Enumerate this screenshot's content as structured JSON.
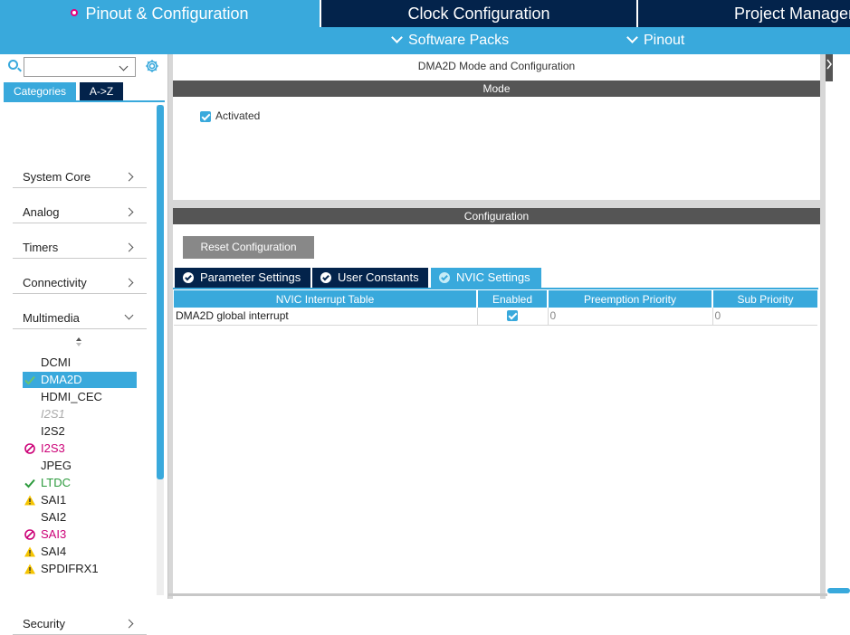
{
  "top_tabs": {
    "pinout": "Pinout & Configuration",
    "clock": "Clock Configuration",
    "project": "Project Manager"
  },
  "sub_menu": {
    "software_packs": "Software Packs",
    "pinout": "Pinout"
  },
  "left": {
    "search": {
      "value": "",
      "placeholder": ""
    },
    "view_tabs": {
      "categories": "Categories",
      "az": "A->Z"
    },
    "categories": [
      {
        "label": "System Core"
      },
      {
        "label": "Analog"
      },
      {
        "label": "Timers"
      },
      {
        "label": "Connectivity"
      },
      {
        "label": "Multimedia"
      },
      {
        "label": "Security"
      }
    ],
    "multimedia_items": [
      {
        "label": "DCMI",
        "status": "none"
      },
      {
        "label": "DMA2D",
        "status": "ok-selected"
      },
      {
        "label": "HDMI_CEC",
        "status": "none"
      },
      {
        "label": "I2S1",
        "status": "disabled"
      },
      {
        "label": "I2S2",
        "status": "none"
      },
      {
        "label": "I2S3",
        "status": "error"
      },
      {
        "label": "JPEG",
        "status": "none"
      },
      {
        "label": "LTDC",
        "status": "ok"
      },
      {
        "label": "SAI1",
        "status": "warning"
      },
      {
        "label": "SAI2",
        "status": "none"
      },
      {
        "label": "SAI3",
        "status": "error"
      },
      {
        "label": "SAI4",
        "status": "warning"
      },
      {
        "label": "SPDIFRX1",
        "status": "warning"
      }
    ]
  },
  "main": {
    "title": "DMA2D Mode and Configuration",
    "mode_header": "Mode",
    "activated_label": "Activated",
    "activated_checked": true,
    "config_header": "Configuration",
    "reset_button": "Reset Configuration",
    "config_tabs": [
      {
        "label": "Parameter Settings",
        "active": false
      },
      {
        "label": "User Constants",
        "active": false
      },
      {
        "label": "NVIC Settings",
        "active": true
      }
    ],
    "nvic_table": {
      "headers": [
        "NVIC Interrupt Table",
        "Enabled",
        "Preemption Priority",
        "Sub Priority"
      ],
      "rows": [
        {
          "name": "DMA2D global interrupt",
          "enabled": true,
          "preemption": "0",
          "sub": "0"
        }
      ]
    }
  },
  "colors": {
    "accent": "#39a9dc",
    "navy": "#03234b",
    "error": "#cc0077",
    "ok": "#2b9a3c",
    "warning": "#f5c400"
  }
}
